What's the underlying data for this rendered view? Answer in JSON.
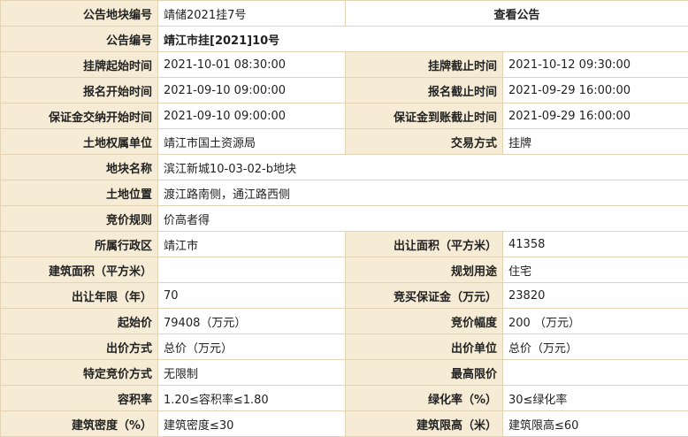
{
  "rows": [
    {
      "type": "link",
      "label": "公告地块编号",
      "value": "靖储2021挂7号",
      "link": "查看公告"
    },
    {
      "type": "single-bold",
      "label": "公告编号",
      "value": "靖江市挂[2021]10号"
    },
    {
      "type": "pair",
      "label": "挂牌起始时间",
      "value": "2021-10-01 08:30:00",
      "label2": "挂牌截止时间",
      "value2": "2021-10-12 09:30:00"
    },
    {
      "type": "pair",
      "label": "报名开始时间",
      "value": "2021-09-10 09:00:00",
      "label2": "报名截止时间",
      "value2": "2021-09-29 16:00:00"
    },
    {
      "type": "pair",
      "label": "保证金交纳开始时间",
      "value": "2021-09-10 09:00:00",
      "label2": "保证金到账截止时间",
      "value2": "2021-09-29 16:00:00"
    },
    {
      "type": "pair",
      "label": "土地权属单位",
      "value": "靖江市国土资源局",
      "label2": "交易方式",
      "value2": "挂牌"
    },
    {
      "type": "single",
      "label": "地块名称",
      "value": "滨江新城10-03-02-b地块"
    },
    {
      "type": "single",
      "label": "土地位置",
      "value": "渡江路南侧，通江路西侧"
    },
    {
      "type": "single",
      "label": "竞价规则",
      "value": "价高者得"
    },
    {
      "type": "pair",
      "label": "所属行政区",
      "value": "靖江市",
      "label2": "出让面积（平方米）",
      "value2": "41358"
    },
    {
      "type": "pair",
      "label": "建筑面积（平方米）",
      "value": "",
      "label2": "规划用途",
      "value2": "住宅"
    },
    {
      "type": "pair",
      "label": "出让年限（年）",
      "value": "70",
      "label2": "竞买保证金（万元）",
      "value2": "23820"
    },
    {
      "type": "pair",
      "label": "起始价",
      "value": "79408（万元）",
      "label2": "竞价幅度",
      "value2": "200 （万元）"
    },
    {
      "type": "pair",
      "label": "出价方式",
      "value": "总价（万元）",
      "label2": "出价单位",
      "value2": "总价（万元）"
    },
    {
      "type": "pair",
      "label": "特定竞价方式",
      "value": "无限制",
      "label2": "最高限价",
      "value2": ""
    },
    {
      "type": "pair",
      "label": "容积率",
      "value": "1.20≤容积率≤1.80",
      "label2": "绿化率（%）",
      "value2": "30≤绿化率"
    },
    {
      "type": "pair",
      "label": "建筑密度（%）",
      "value": "建筑密度≤30",
      "label2": "建筑限高（米）",
      "value2": "建筑限高≤60"
    }
  ]
}
